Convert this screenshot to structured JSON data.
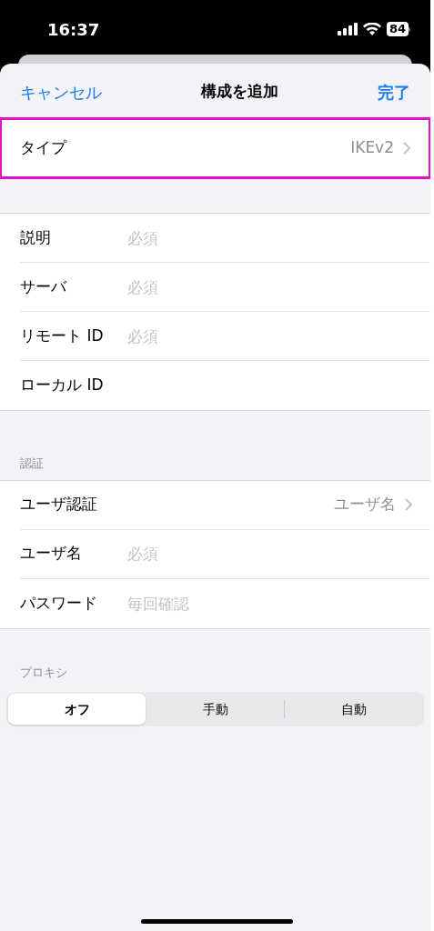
{
  "status_bar": {
    "time": "16:37",
    "battery": "84"
  },
  "nav": {
    "cancel": "キャンセル",
    "title": "構成を追加",
    "done": "完了"
  },
  "type_row": {
    "label": "タイプ",
    "value": "IKEv2",
    "highlighted": true
  },
  "fields": [
    {
      "label": "説明",
      "placeholder": "必須"
    },
    {
      "label": "サーバ",
      "placeholder": "必須"
    },
    {
      "label": "リモート ID",
      "placeholder": "必須"
    },
    {
      "label": "ローカル ID"
    }
  ],
  "auth": {
    "header": "認証",
    "rows": [
      {
        "kind": "select",
        "label": "ユーザ認証",
        "value": "ユーザ名"
      },
      {
        "kind": "field",
        "label": "ユーザ名",
        "placeholder": "必須"
      },
      {
        "kind": "field",
        "label": "パスワード",
        "placeholder": "毎回確認"
      }
    ]
  },
  "proxy": {
    "header": "プロキシ",
    "segments": [
      {
        "label": "オフ",
        "selected": true
      },
      {
        "label": "手動",
        "selected": false
      },
      {
        "label": "自動",
        "selected": false
      }
    ]
  }
}
